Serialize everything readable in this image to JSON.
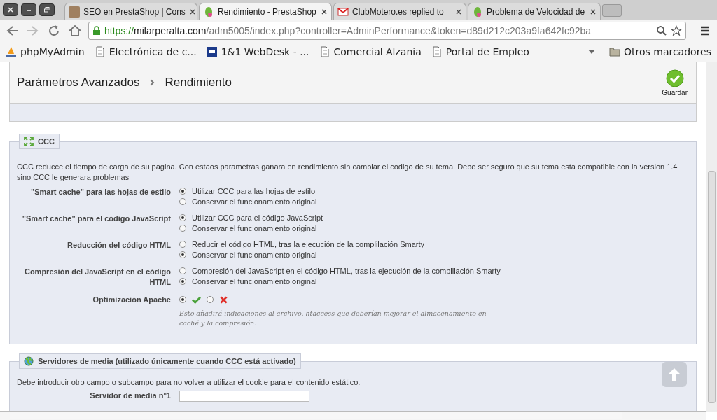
{
  "browser": {
    "tabs": [
      {
        "title": "SEO en PrestaShop | Cons",
        "kind": "avatar",
        "selected": false
      },
      {
        "title": "Rendimiento - PrestaShop",
        "kind": "prestashop",
        "selected": true
      },
      {
        "title": "ClubMotero.es replied to",
        "kind": "mail",
        "selected": false
      },
      {
        "title": "Problema de Velocidad de",
        "kind": "prestashop",
        "selected": false
      }
    ],
    "address": {
      "scheme": "https://",
      "host": "milarperalta.com",
      "path": "/adm5005/index.php?controller=AdminPerformance&token=d89d212c203a9fa642fc92ba"
    },
    "bookmarks": [
      {
        "label": "phpMyAdmin",
        "kind": "pma"
      },
      {
        "label": "Electrónica de c...",
        "kind": "page"
      },
      {
        "label": "1&1 WebDesk - ...",
        "kind": "oneandone"
      },
      {
        "label": "Comercial Alzania",
        "kind": "page"
      },
      {
        "label": "Portal de Empleo",
        "kind": "page"
      }
    ],
    "other_bookmarks": "Otros marcadores"
  },
  "header": {
    "breadcrumb": [
      "Parámetros Avanzados",
      "Rendimiento"
    ],
    "save_label": "Guardar"
  },
  "ccc": {
    "legend": "CCC",
    "description": "CCC reducce el tiempo de carga de su pagina. Con estaos parametras ganara en rendimiento sin cambiar el codigo de su tema. Debe ser seguro que su tema esta compatible con la version 1.4 sino CCC le generara problemas",
    "rows": [
      {
        "kind": "radio-list",
        "label": "\"Smart cache\" para las hojas de estilo",
        "options": [
          {
            "label": "Utilizar CCC para las hojas de estilo",
            "selected": true
          },
          {
            "label": "Conservar el funcionamiento original",
            "selected": false
          }
        ]
      },
      {
        "kind": "radio-list",
        "label": "\"Smart cache\" para el código JavaScript",
        "options": [
          {
            "label": "Utilizar CCC para el código JavaScript",
            "selected": true
          },
          {
            "label": "Conservar el funcionamiento original",
            "selected": false
          }
        ]
      },
      {
        "kind": "radio-list",
        "label": "Reducción del código HTML",
        "options": [
          {
            "label": "Reducir el código HTML, tras la ejecución de la complilación Smarty",
            "selected": false
          },
          {
            "label": "Conservar el funcionamiento original",
            "selected": true
          }
        ]
      },
      {
        "kind": "radio-list",
        "label": "Compresión del JavaScript en el código HTML",
        "options": [
          {
            "label": "Compresión del JavaScript en el código HTML, tras la ejecución de la complilación Smarty",
            "selected": false
          },
          {
            "label": "Conservar el funcionamiento original",
            "selected": true
          }
        ]
      },
      {
        "kind": "toggle",
        "label": "Optimización Apache",
        "options": [
          {
            "kind": "yes",
            "selected": true
          },
          {
            "kind": "no",
            "selected": false
          }
        ],
        "hint": "Esto añadirá indicaciones al archivo. htaccess que deberían mejorar el almacenamiento en caché y la compresión."
      }
    ]
  },
  "media": {
    "legend": "Servidores de media (utilizado únicamente cuando CCC está activado)",
    "description": "Debe introducir otro campo o subcampo para no volver a utilizar el cookie para el contenido estático.",
    "fields": [
      {
        "label": "Servidor de media n°1"
      }
    ]
  }
}
